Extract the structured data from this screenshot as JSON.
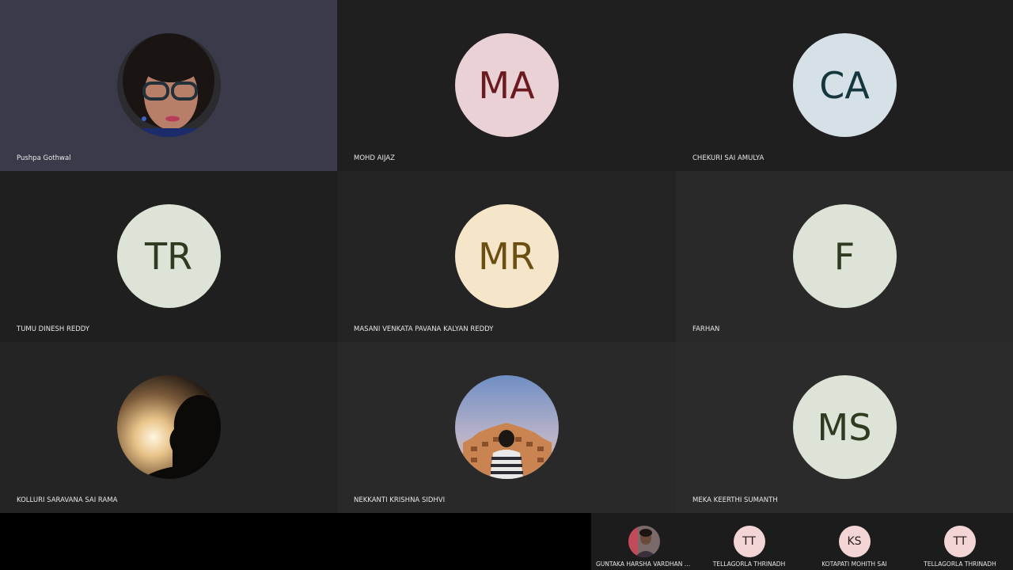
{
  "participants": [
    {
      "name": "Pushpa Gothwal",
      "initials": "",
      "photo": "woman-glasses-photo"
    },
    {
      "name": "MOHD AIJAZ",
      "initials": "MA",
      "avatar_bg": "#ead1d6",
      "avatar_fg": "#6b1a1f"
    },
    {
      "name": "CHEKURI SAI AMULYA",
      "initials": "CA",
      "avatar_bg": "#d6e1e7",
      "avatar_fg": "#13373d"
    },
    {
      "name": "TUMU DINESH REDDY",
      "initials": "TR",
      "avatar_bg": "#dde3d7",
      "avatar_fg": "#2f3a21"
    },
    {
      "name": "MASANI VENKATA PAVANA KALYAN REDDY",
      "initials": "MR",
      "avatar_bg": "#f5e6c9",
      "avatar_fg": "#6b4f12"
    },
    {
      "name": "FARHAN",
      "initials": "F",
      "avatar_bg": "#dde3d7",
      "avatar_fg": "#2f3a21"
    },
    {
      "name": "KOLLURI SARAVANA SAI RAMA",
      "initials": "",
      "photo": "silhouette-sunset-photo"
    },
    {
      "name": "NEKKANTI KRISHNA SIDHVI",
      "initials": "",
      "photo": "hawa-mahal-photo"
    },
    {
      "name": "MEKA KEERTHI SUMANTH",
      "initials": "MS",
      "avatar_bg": "#dde3d7",
      "avatar_fg": "#2f3a21"
    }
  ],
  "overflow_participants": [
    {
      "name": "GUNTAKA HARSHA VARDHAN KU...",
      "initials": "",
      "photo": "man-photo"
    },
    {
      "name": "TELLAGORLA THRINADH",
      "initials": "TT",
      "avatar_bg": "#f3d5d5",
      "avatar_fg": "#3a1c1c"
    },
    {
      "name": "KOTAPATI MOHITH SAI",
      "initials": "KS",
      "avatar_bg": "#f3d5d5",
      "avatar_fg": "#3a1c1c"
    },
    {
      "name": "TELLAGORLA THRINADH",
      "initials": "TT",
      "avatar_bg": "#f3d5d5",
      "avatar_fg": "#3a1c1c"
    }
  ]
}
